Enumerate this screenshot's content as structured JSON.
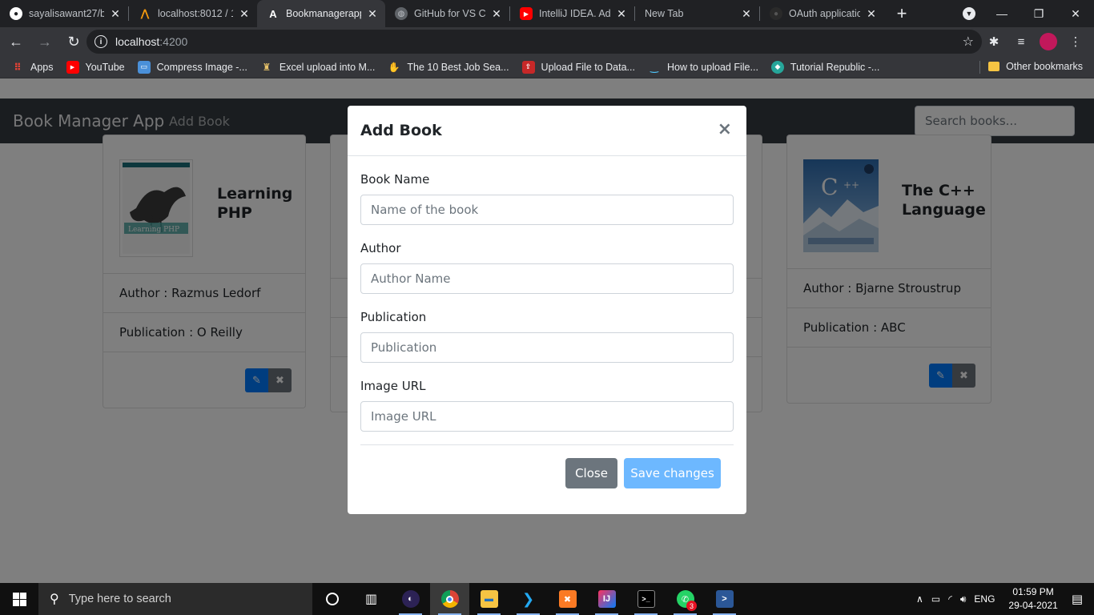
{
  "browser": {
    "tabs": [
      {
        "title": "sayalisawant27/b",
        "icon": "github-icon",
        "active": false
      },
      {
        "title": "localhost:8012 / 1",
        "icon": "phpmyadmin-icon",
        "active": false
      },
      {
        "title": "Bookmanagerapp",
        "icon": "angular-icon",
        "active": true
      },
      {
        "title": "GitHub for VS Co",
        "icon": "globe-icon",
        "active": false
      },
      {
        "title": "IntelliJ IDEA. Addi",
        "icon": "youtube-icon",
        "active": false
      },
      {
        "title": "New Tab",
        "icon": "",
        "active": false
      },
      {
        "title": "OAuth application",
        "icon": "github-icon",
        "active": false
      }
    ],
    "url_host": "localhost",
    "url_port": ":4200",
    "bookmarks": [
      {
        "label": "Apps",
        "icon": "apps-grid-icon"
      },
      {
        "label": "YouTube",
        "icon": "youtube-icon"
      },
      {
        "label": "Compress Image -...",
        "icon": "image-icon"
      },
      {
        "label": "Excel upload into M...",
        "icon": "trophy-icon"
      },
      {
        "label": "The 10 Best Job Sea...",
        "icon": "hand-icon"
      },
      {
        "label": "Upload File to Data...",
        "icon": "upload-icon"
      },
      {
        "label": "How to upload File...",
        "icon": "smile-icon"
      },
      {
        "label": "Tutorial Republic -...",
        "icon": "tr-icon"
      }
    ],
    "other_bookmarks": "Other bookmarks"
  },
  "app": {
    "brand": "Book Manager App",
    "nav_add": "Add Book",
    "search_placeholder": "Search books..."
  },
  "books": [
    {
      "title": "Learning PHP",
      "author": "Author : Razmus Ledorf",
      "publication": "Publication : O Reilly"
    },
    {
      "title": "The C++ Language",
      "author": "Author : Bjarne Stroustrup",
      "publication": "Publication : ABC"
    }
  ],
  "modal": {
    "title": "Add Book",
    "close_glyph": "×",
    "fields": [
      {
        "label": "Book Name",
        "placeholder": "Name of the book"
      },
      {
        "label": "Author",
        "placeholder": "Author Name"
      },
      {
        "label": "Publication",
        "placeholder": "Publication"
      },
      {
        "label": "Image URL",
        "placeholder": "Image URL"
      }
    ],
    "close_label": "Close",
    "save_label": "Save changes"
  },
  "taskbar": {
    "search_placeholder": "Type here to search",
    "language": "ENG",
    "time": "01:59 PM",
    "date": "29-04-2021",
    "whatsapp_badge": "3"
  },
  "colors": {
    "primary": "#007bff",
    "secondary": "#6c757d",
    "navbar": "#343a40",
    "save_disabled": "#6db8ff"
  }
}
